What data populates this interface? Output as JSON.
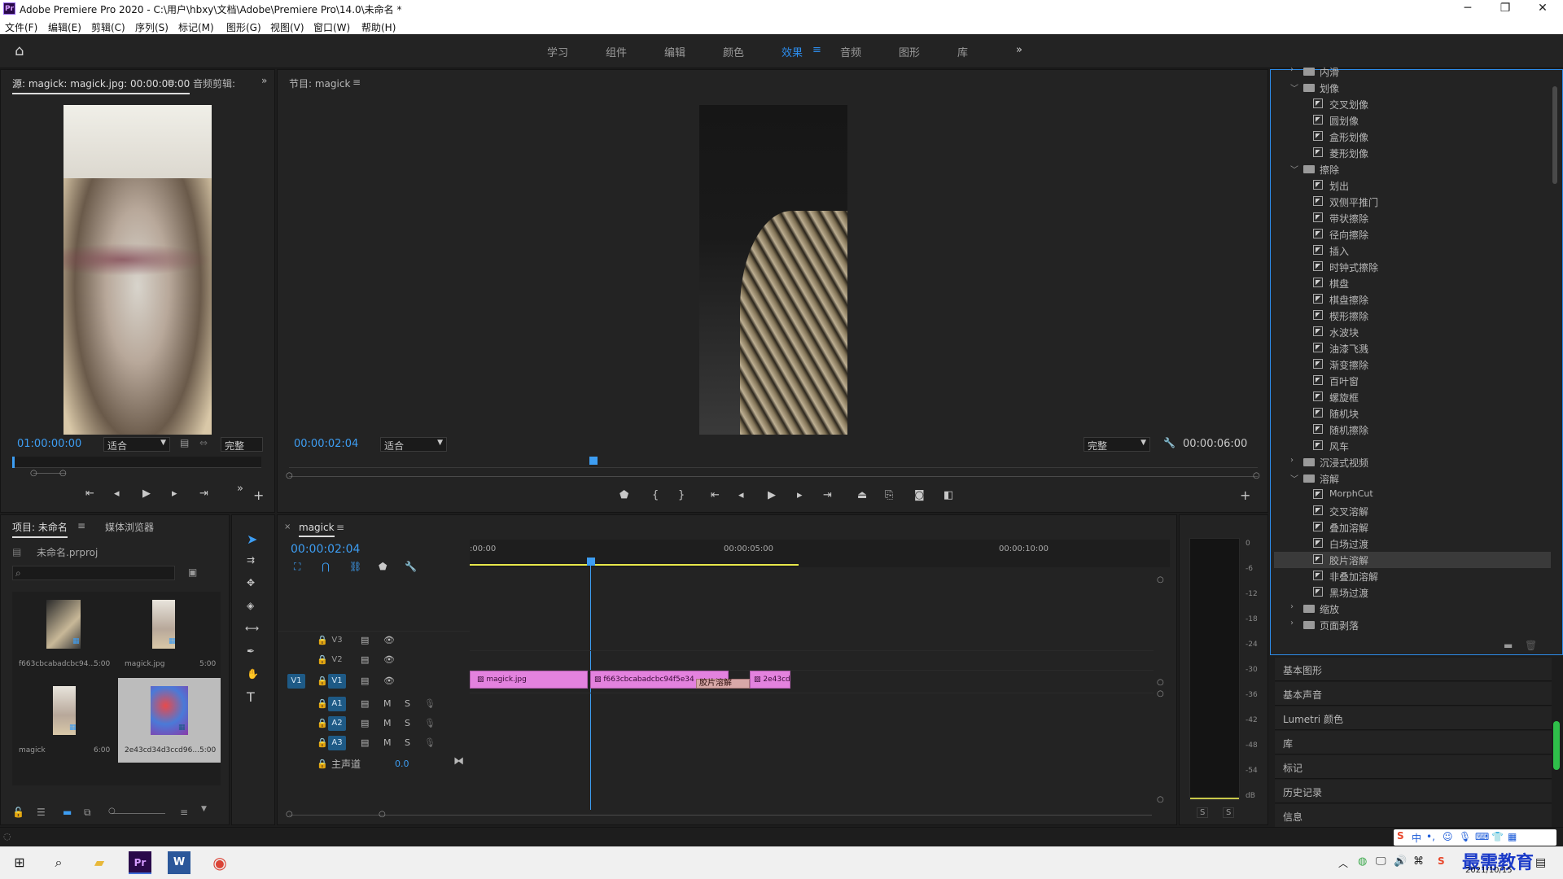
{
  "window": {
    "title": "Adobe Premiere Pro 2020 - C:\\用户\\hbxy\\文档\\Adobe\\Premiere Pro\\14.0\\未命名 *",
    "logo": "Pr"
  },
  "menu": [
    "文件(F)",
    "编辑(E)",
    "剪辑(C)",
    "序列(S)",
    "标记(M)",
    "图形(G)",
    "视图(V)",
    "窗口(W)",
    "帮助(H)"
  ],
  "workspaces": [
    {
      "label": "学习",
      "active": false
    },
    {
      "label": "组件",
      "active": false
    },
    {
      "label": "编辑",
      "active": false
    },
    {
      "label": "颜色",
      "active": false
    },
    {
      "label": "效果",
      "active": true
    },
    {
      "label": "音频",
      "active": false
    },
    {
      "label": "图形",
      "active": false
    },
    {
      "label": "库",
      "active": false
    }
  ],
  "source_monitor": {
    "tab_active": "源: magick: magick.jpg: 00:00:00:00",
    "tab_other": "音频剪辑:",
    "timecode": "01:00:00:00",
    "fit": "适合",
    "quality": "完整"
  },
  "program_monitor": {
    "tab": "节目: magick",
    "timecode": "00:00:02:04",
    "fit": "适合",
    "quality": "完整",
    "duration": "00:00:06:00",
    "playhead_progress": 0.25
  },
  "project": {
    "tab_active": "项目: 未命名",
    "tab_other": "媒体浏览器",
    "file": "未命名.prproj",
    "items": [
      {
        "name": "f663cbcabadcbc94...",
        "duration": "5:00"
      },
      {
        "name": "magick.jpg",
        "duration": "5:00"
      },
      {
        "name": "magick",
        "duration": "6:00"
      },
      {
        "name": "2e43cd34d3ccd96...",
        "duration": "5:00"
      }
    ]
  },
  "timeline": {
    "tab": "magick",
    "timecode": "00:00:02:04",
    "ruler": [
      ":00:00",
      "00:00:05:00",
      "00:00:10:00"
    ],
    "video_tracks": [
      "V3",
      "V2",
      "V1"
    ],
    "audio_tracks": [
      "A1",
      "A2",
      "A3"
    ],
    "source_patch": "V1",
    "track_m": "M",
    "track_s": "S",
    "master_label": "主声道",
    "master_value": "0.0",
    "clips": [
      {
        "label": "magick.jpg"
      },
      {
        "label": "f663cbcabadcbc94f5e34"
      },
      {
        "label": "2e43cd"
      }
    ],
    "transition": "胶片溶解"
  },
  "meter": {
    "db": [
      "0",
      "-6",
      "-12",
      "-18",
      "-24",
      "-30",
      "-36",
      "-42",
      "-48",
      "-54",
      "dB"
    ],
    "solo": [
      "S",
      "S"
    ]
  },
  "effects_tree": [
    {
      "type": "folder",
      "label": "内滑",
      "depth": 1,
      "open": false
    },
    {
      "type": "folder",
      "label": "划像",
      "depth": 1,
      "open": true
    },
    {
      "type": "fx",
      "label": "交叉划像",
      "depth": 2
    },
    {
      "type": "fx",
      "label": "圆划像",
      "depth": 2
    },
    {
      "type": "fx",
      "label": "盒形划像",
      "depth": 2
    },
    {
      "type": "fx",
      "label": "菱形划像",
      "depth": 2
    },
    {
      "type": "folder",
      "label": "擦除",
      "depth": 1,
      "open": true
    },
    {
      "type": "fx",
      "label": "划出",
      "depth": 2
    },
    {
      "type": "fx",
      "label": "双侧平推门",
      "depth": 2
    },
    {
      "type": "fx",
      "label": "带状擦除",
      "depth": 2
    },
    {
      "type": "fx",
      "label": "径向擦除",
      "depth": 2
    },
    {
      "type": "fx",
      "label": "插入",
      "depth": 2
    },
    {
      "type": "fx",
      "label": "时钟式擦除",
      "depth": 2
    },
    {
      "type": "fx",
      "label": "棋盘",
      "depth": 2
    },
    {
      "type": "fx",
      "label": "棋盘擦除",
      "depth": 2
    },
    {
      "type": "fx",
      "label": "楔形擦除",
      "depth": 2
    },
    {
      "type": "fx",
      "label": "水波块",
      "depth": 2
    },
    {
      "type": "fx",
      "label": "油漆飞溅",
      "depth": 2
    },
    {
      "type": "fx",
      "label": "渐变擦除",
      "depth": 2
    },
    {
      "type": "fx",
      "label": "百叶窗",
      "depth": 2
    },
    {
      "type": "fx",
      "label": "螺旋框",
      "depth": 2
    },
    {
      "type": "fx",
      "label": "随机块",
      "depth": 2
    },
    {
      "type": "fx",
      "label": "随机擦除",
      "depth": 2
    },
    {
      "type": "fx",
      "label": "风车",
      "depth": 2
    },
    {
      "type": "folder",
      "label": "沉浸式视频",
      "depth": 1,
      "open": false
    },
    {
      "type": "folder",
      "label": "溶解",
      "depth": 1,
      "open": true
    },
    {
      "type": "fx",
      "label": "MorphCut",
      "depth": 2
    },
    {
      "type": "fx",
      "label": "交叉溶解",
      "depth": 2
    },
    {
      "type": "fx",
      "label": "叠加溶解",
      "depth": 2
    },
    {
      "type": "fx",
      "label": "白场过渡",
      "depth": 2
    },
    {
      "type": "fx",
      "label": "胶片溶解",
      "depth": 2,
      "selected": true
    },
    {
      "type": "fx",
      "label": "非叠加溶解",
      "depth": 2
    },
    {
      "type": "fx",
      "label": "黑场过渡",
      "depth": 2
    },
    {
      "type": "folder",
      "label": "缩放",
      "depth": 1,
      "open": false
    },
    {
      "type": "folder",
      "label": "页面剥落",
      "depth": 1,
      "open": false
    }
  ],
  "side_panels": [
    "基本图形",
    "基本声音",
    "Lumetri 颜色",
    "库",
    "标记",
    "历史记录",
    "信息"
  ],
  "taskbar": {
    "ime": "中",
    "brand": "最需教育",
    "date": "2021/10/15"
  }
}
